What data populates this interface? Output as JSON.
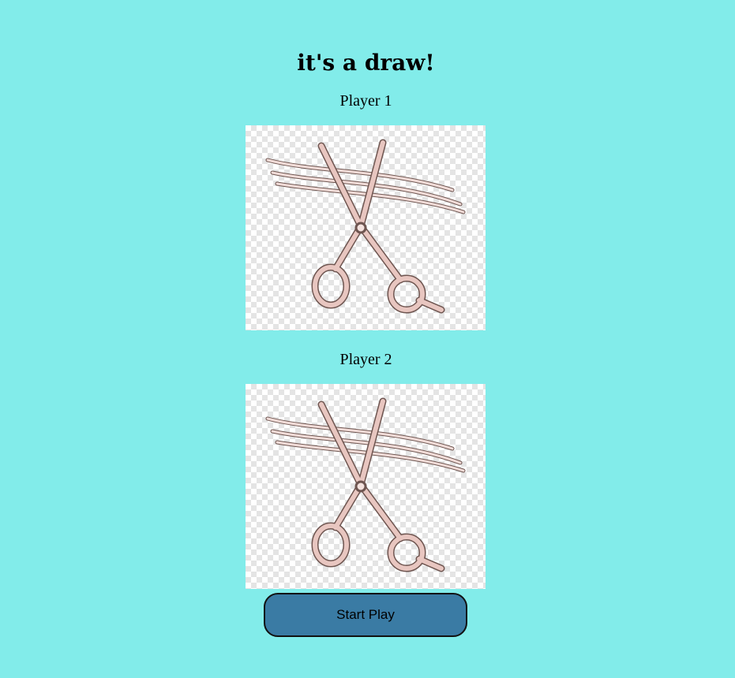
{
  "result": {
    "title": "it's a draw!"
  },
  "players": [
    {
      "label": "Player 1",
      "choice": "scissors",
      "icon": "scissors-icon"
    },
    {
      "label": "Player 2",
      "choice": "scissors",
      "icon": "scissors-icon"
    }
  ],
  "controls": {
    "start_label": "Start Play"
  },
  "colors": {
    "background": "#82ecea",
    "button": "#3a7ba4",
    "scissors": "#c9a39b"
  }
}
